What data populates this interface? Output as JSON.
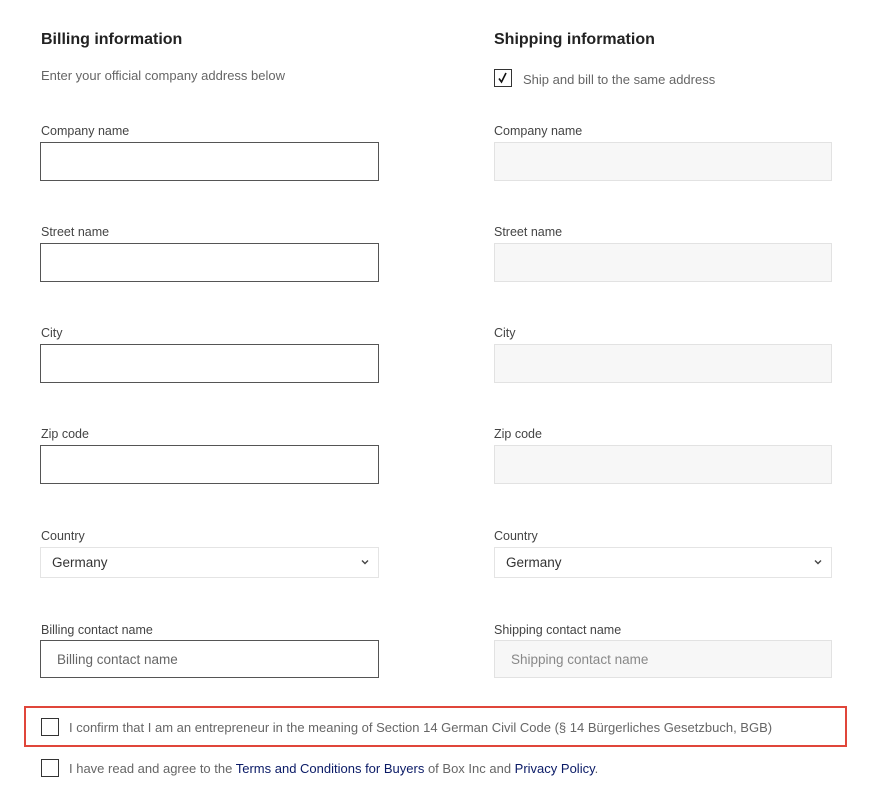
{
  "billing": {
    "heading": "Billing information",
    "subtext": "Enter your official company address below",
    "company_label": "Company name",
    "street_label": "Street name",
    "city_label": "City",
    "zip_label": "Zip code",
    "country_label": "Country",
    "country_value": "Germany",
    "contact_label": "Billing contact name",
    "contact_placeholder": "Billing contact name"
  },
  "shipping": {
    "heading": "Shipping information",
    "same_address_label": "Ship and bill to the same address",
    "same_address_checked": true,
    "company_label": "Company name",
    "street_label": "Street name",
    "city_label": "City",
    "zip_label": "Zip code",
    "country_label": "Country",
    "country_value": "Germany",
    "contact_label": "Shipping contact name",
    "contact_placeholder": "Shipping contact name"
  },
  "consent": {
    "entrepreneur_text": "I confirm that I am an entrepreneur in the meaning of Section 14 German Civil Code (§ 14 Bürgerliches Gesetzbuch, BGB)",
    "terms_prefix": "I have read and agree to the ",
    "terms_link": "Terms and Conditions for Buyers",
    "terms_middle": " of Box Inc and ",
    "privacy_link": "Privacy Policy",
    "terms_suffix": "."
  },
  "colors": {
    "highlight_border": "#e0463a",
    "link": "#0a1a66"
  }
}
